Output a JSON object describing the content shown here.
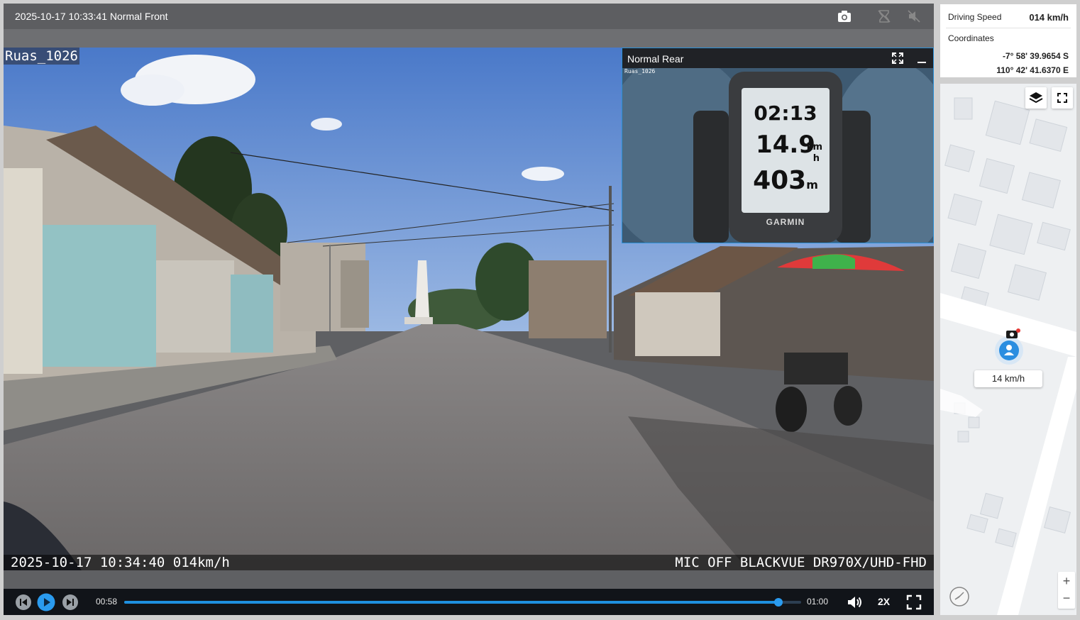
{
  "header": {
    "title": "2025-10-17 10:33:41 Normal Front",
    "icons": [
      "camera-icon",
      "hourglass-off-icon",
      "mute-icon"
    ]
  },
  "video": {
    "camera_label": "Ruas_1026",
    "osd_left": "2025-10-17 10:34:40 014km/h",
    "osd_right": "MIC OFF BLACKVUE DR970X/UHD-FHD"
  },
  "pip": {
    "title": "Normal Rear",
    "stamp": "Ruas_1026",
    "gauge": {
      "brand": "GARMIN",
      "time": "02:13",
      "speed": "14.9",
      "speed_unit_top": "km",
      "speed_unit_bottom": "h",
      "distance": "403",
      "distance_unit": "m"
    }
  },
  "controls": {
    "current_time": "00:58",
    "total_time": "01:00",
    "progress": 0.966,
    "playback_rate": "2X"
  },
  "info": {
    "speed_label": "Driving Speed",
    "speed_value": "014 km/h",
    "coords_label": "Coordinates",
    "lat": "-7° 58' 39.9654 S",
    "lon": "110° 42' 41.6370 E"
  },
  "map": {
    "marker_speed": "14 km/h",
    "zoom_in": "+",
    "zoom_out": "−"
  },
  "colors": {
    "accent": "#1e90e0",
    "topbar": "#5d5e61",
    "controls_bg": "#111419"
  }
}
